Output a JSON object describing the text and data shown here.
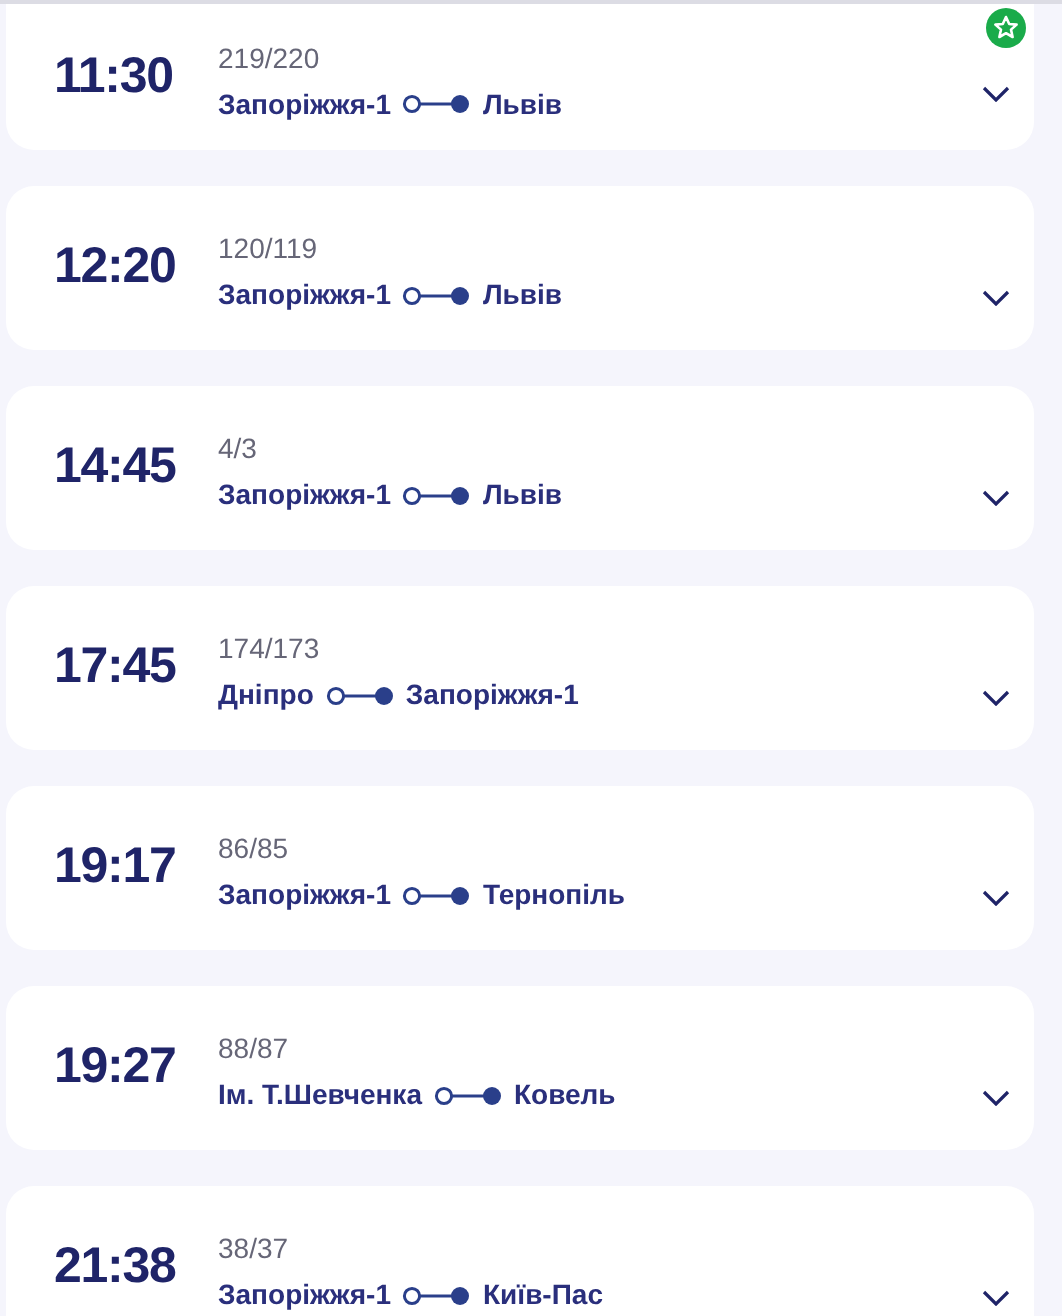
{
  "trains": [
    {
      "time": "11:30",
      "number": "219/220",
      "from": "Запоріжжя-1",
      "to": "Львів",
      "favorite": true
    },
    {
      "time": "12:20",
      "number": "120/119",
      "from": "Запоріжжя-1",
      "to": "Львів",
      "favorite": false
    },
    {
      "time": "14:45",
      "number": "4/3",
      "from": "Запоріжжя-1",
      "to": "Львів",
      "favorite": false
    },
    {
      "time": "17:45",
      "number": "174/173",
      "from": "Дніпро",
      "to": "Запоріжжя-1",
      "favorite": false
    },
    {
      "time": "19:17",
      "number": "86/85",
      "from": "Запоріжжя-1",
      "to": "Тернопіль",
      "favorite": false
    },
    {
      "time": "19:27",
      "number": "88/87",
      "from": "Ім. Т.Шевченка",
      "to": "Ковель",
      "favorite": false
    },
    {
      "time": "21:38",
      "number": "38/37",
      "from": "Запоріжжя-1",
      "to": "Київ-Пас",
      "favorite": false
    }
  ]
}
